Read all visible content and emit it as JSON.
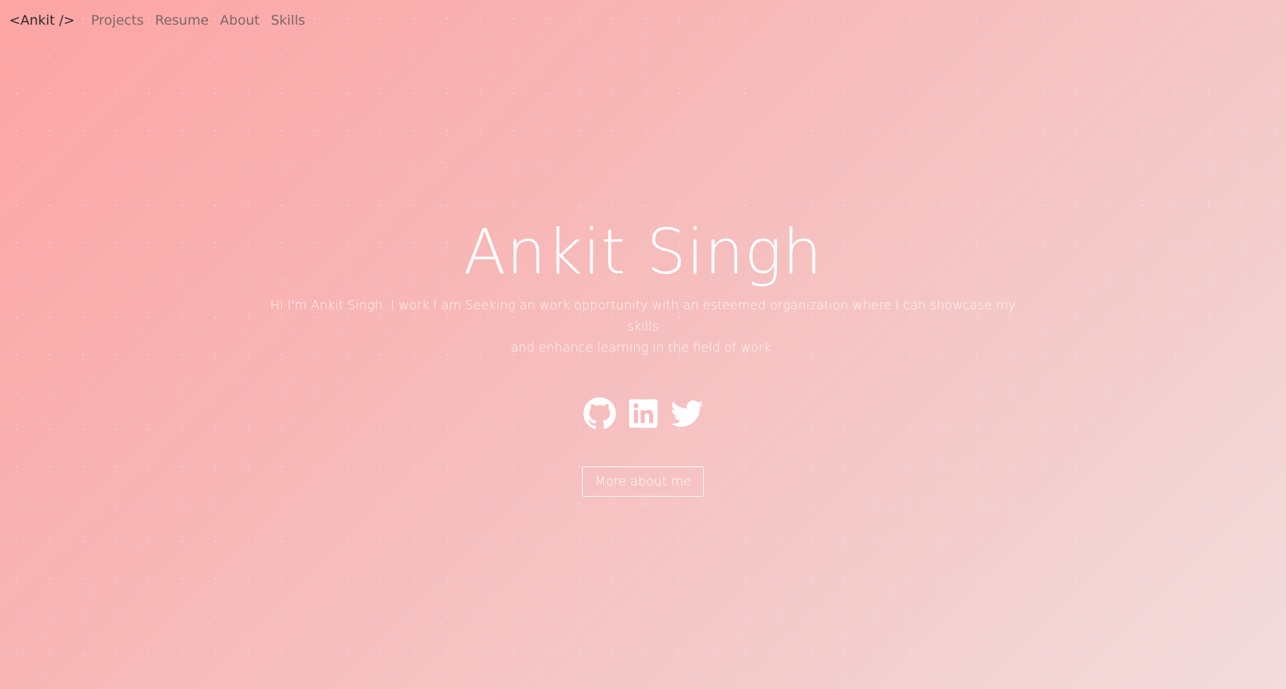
{
  "nav": {
    "brand": "<Ankit />",
    "links": [
      "Projects",
      "Resume",
      "About",
      "Skills"
    ]
  },
  "hero": {
    "name": "Ankit Singh",
    "intro_line1": "Hi I'm Ankit Singh. I work I am Seeking an work opportunity with an esteemed organization where I can showcase my skills",
    "intro_line2": "and enhance learning in the field of work.",
    "button_label": "More about me"
  },
  "socials": [
    {
      "icon": "github-icon"
    },
    {
      "icon": "linkedin-icon"
    },
    {
      "icon": "twitter-icon"
    }
  ],
  "colors": {
    "gradient_start": "#fda4a4",
    "gradient_end": "#f2dcdc",
    "text_light": "#ffffff",
    "brand_text": "#2e2626",
    "nav_text": "#7d6666"
  }
}
